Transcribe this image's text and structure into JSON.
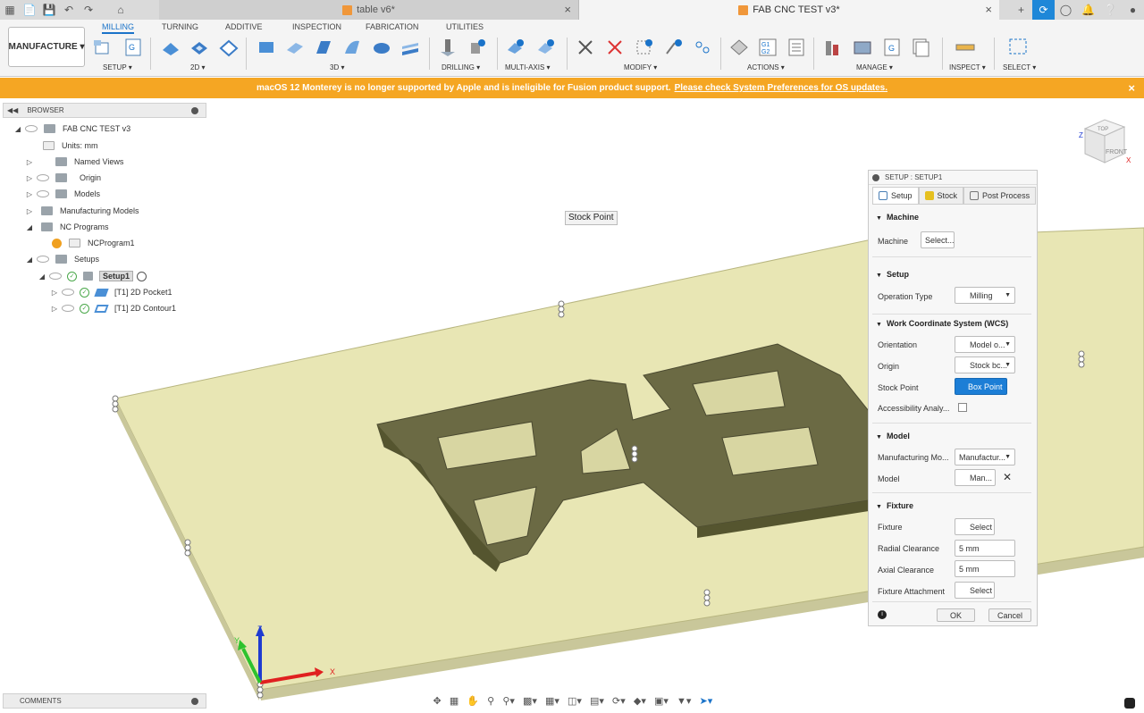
{
  "titlebar": {
    "tabs": [
      {
        "label": "table v6*",
        "active": false
      },
      {
        "label": "FAB CNC TEST v3*",
        "active": true
      }
    ],
    "close_glyph": "×",
    "new_tab_glyph": "+"
  },
  "ribbon": {
    "workspace": "MANUFACTURE",
    "tabs": [
      "MILLING",
      "TURNING",
      "ADDITIVE",
      "INSPECTION",
      "FABRICATION",
      "UTILITIES"
    ],
    "groups": [
      "SETUP ▾",
      "2D ▾",
      "3D ▾",
      "DRILLING ▾",
      "MULTI-AXIS ▾",
      "MODIFY ▾",
      "ACTIONS ▾",
      "MANAGE ▾",
      "INSPECT ▾",
      "SELECT ▾"
    ]
  },
  "banner": {
    "message": "macOS 12 Monterey is no longer supported by Apple and is ineligible for Fusion product support.",
    "link": "Please check System Preferences for OS updates.",
    "close": "×"
  },
  "browser": {
    "title": "BROWSER",
    "items": [
      {
        "label": "FAB CNC TEST v3"
      },
      {
        "label": "Units: mm"
      },
      {
        "label": "Named Views"
      },
      {
        "label": "Origin"
      },
      {
        "label": "Models"
      },
      {
        "label": "Manufacturing Models"
      },
      {
        "label": "NC Programs"
      },
      {
        "label": "NCProgram1"
      },
      {
        "label": "Setups"
      },
      {
        "label": "Setup1"
      },
      {
        "label": "[T1] 2D Pocket1"
      },
      {
        "label": "[T1] 2D Contour1"
      }
    ]
  },
  "tooltip": "Stock Point",
  "dialog": {
    "title": "SETUP : SETUP1",
    "tabs": [
      "Setup",
      "Stock",
      "Post Process"
    ],
    "sections": {
      "machine": "Machine",
      "setup": "Setup",
      "wcs": "Work Coordinate System (WCS)",
      "model": "Model",
      "fixture": "Fixture"
    },
    "fields": {
      "machine_label": "Machine",
      "machine_value": "Select...",
      "operation_type_label": "Operation Type",
      "operation_type_value": "Milling",
      "orientation_label": "Orientation",
      "orientation_value": "Model o...",
      "origin_label": "Origin",
      "origin_value": "Stock bc...",
      "stock_point_label": "Stock Point",
      "stock_point_value": "Box Point",
      "accessibility_label": "Accessibility Analy...",
      "mfg_model_label": "Manufacturing Mo...",
      "mfg_model_value": "Manufactur...",
      "model_label": "Model",
      "model_value": "Man...",
      "fixture_label": "Fixture",
      "fixture_value": "Select",
      "radial_label": "Radial Clearance",
      "radial_value": "5 mm",
      "axial_label": "Axial Clearance",
      "axial_value": "5 mm",
      "attachment_label": "Fixture Attachment",
      "attachment_value": "Select"
    },
    "ok": "OK",
    "cancel": "Cancel"
  },
  "comments": "COMMENTS",
  "viewcube": {
    "top": "TOP",
    "front": "FRONT",
    "x": "X",
    "z": "Z"
  },
  "axes": {
    "x": "X",
    "y": "Y",
    "z": "Z"
  },
  "colors": {
    "accent": "#1a73c9",
    "banner": "#f5a623",
    "stock": "#e8e6b4",
    "part": "#6b6a44"
  }
}
